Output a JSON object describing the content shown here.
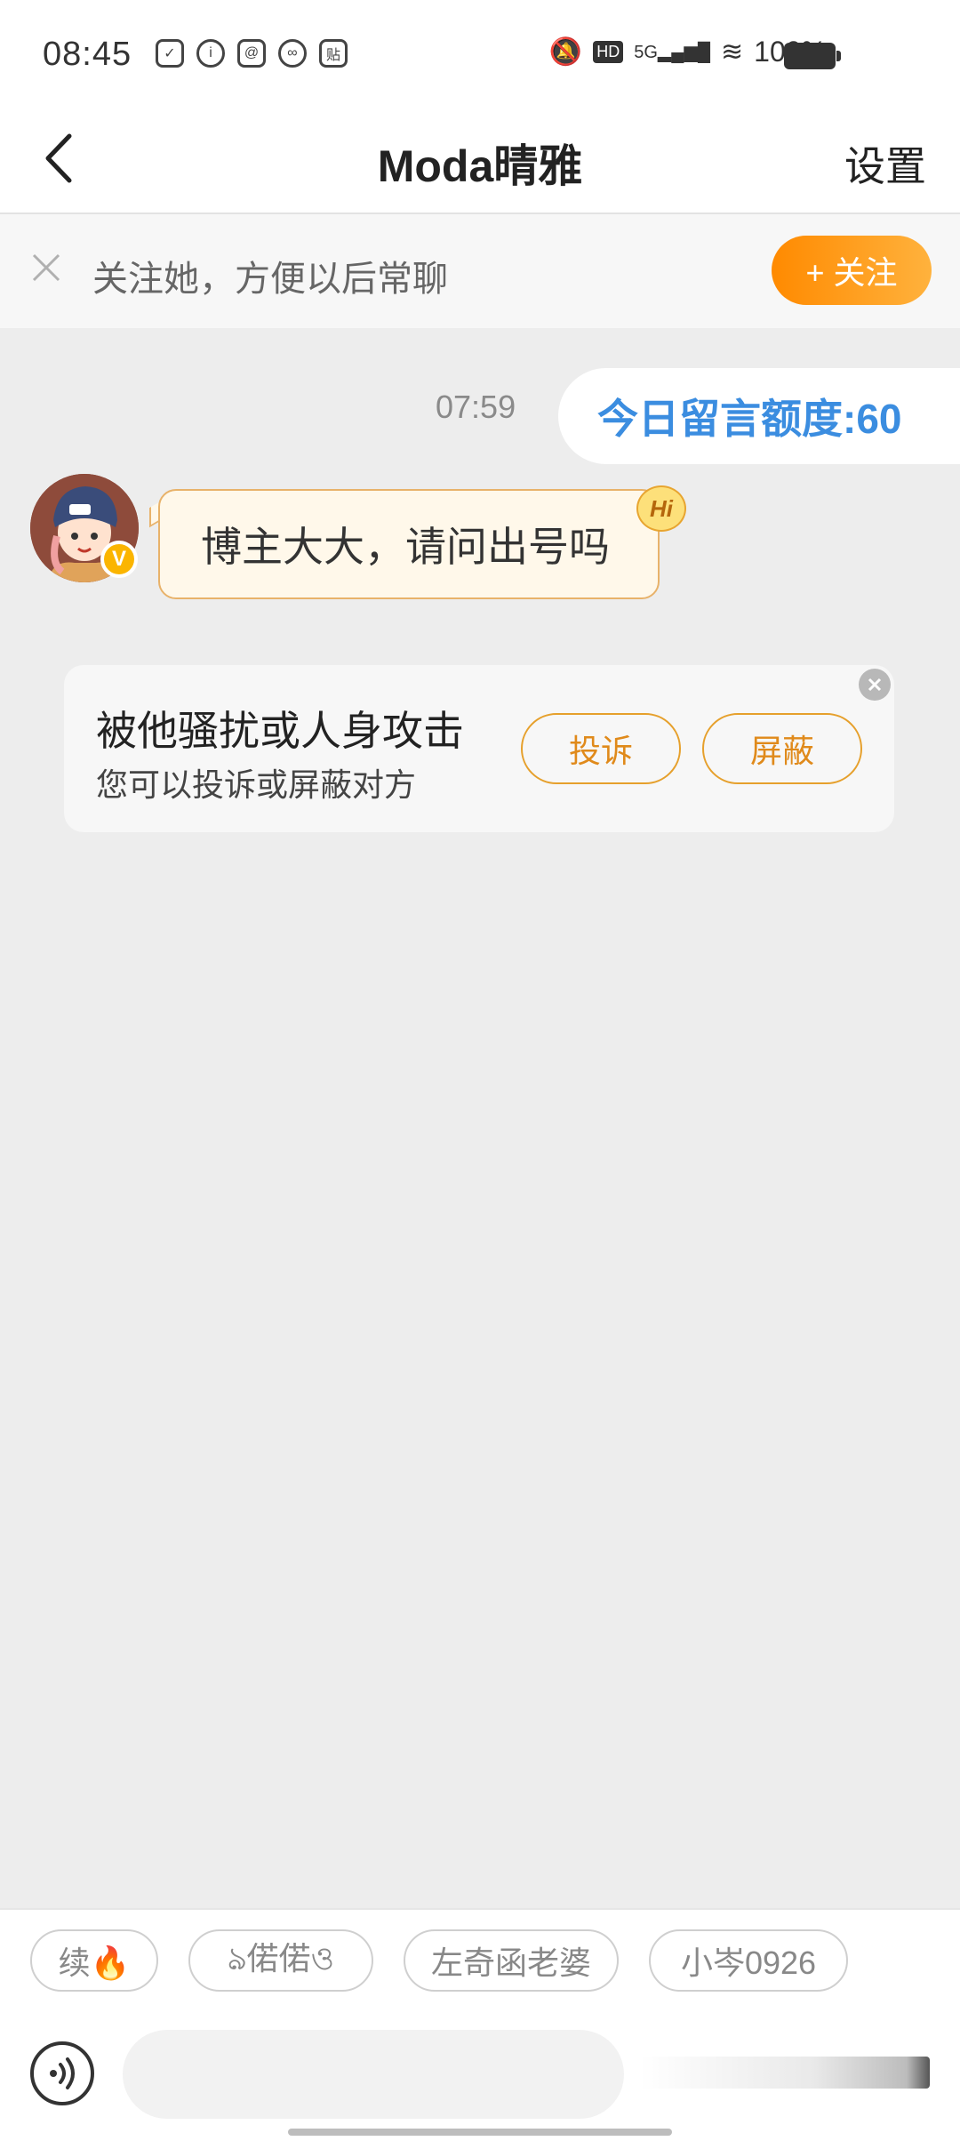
{
  "status_bar": {
    "time": "08:45",
    "battery": "100%",
    "network": "5G"
  },
  "header": {
    "title": "Moda晴雅",
    "settings_label": "设置"
  },
  "follow_banner": {
    "text": "关注她，方便以后常聊",
    "button_label": "+ 关注"
  },
  "chat": {
    "timestamp": "07:59",
    "quota_label": "今日留言额度:60",
    "incoming_message": "博主大大，请问出号吗",
    "hi_badge": "Hi",
    "verified_badge": "V"
  },
  "report_card": {
    "title": "被他骚扰或人身攻击",
    "subtitle": "您可以投诉或屏蔽对方",
    "report_label": "投诉",
    "block_label": "屏蔽"
  },
  "suggestions": [
    {
      "label": "续🔥"
    },
    {
      "label": "ঌ偌偌ও"
    },
    {
      "label": "左奇函老婆"
    },
    {
      "label": "小岑0926"
    }
  ],
  "colors": {
    "accent_orange": "#ff9a1a",
    "quota_blue": "#3b8de0",
    "background": "#ededed"
  }
}
